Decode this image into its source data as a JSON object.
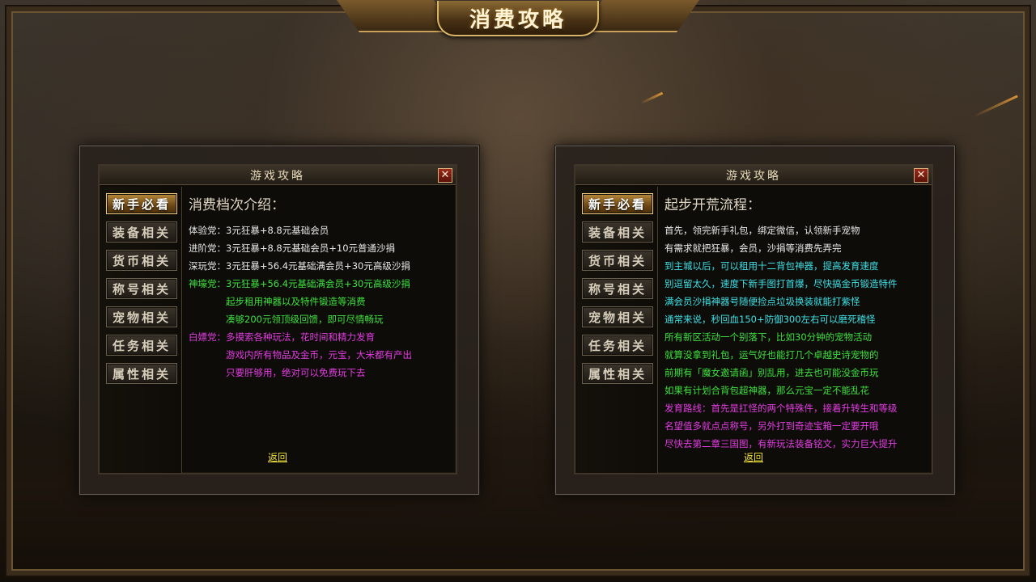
{
  "banner": {
    "title": "消费攻略"
  },
  "left_panel": {
    "window_title": "游戏攻略",
    "close_label": "✕",
    "sidebar": [
      {
        "label": "新手必看",
        "active": true
      },
      {
        "label": "装备相关",
        "active": false
      },
      {
        "label": "货币相关",
        "active": false
      },
      {
        "label": "称号相关",
        "active": false
      },
      {
        "label": "宠物相关",
        "active": false
      },
      {
        "label": "任务相关",
        "active": false
      },
      {
        "label": "属性相关",
        "active": false
      }
    ],
    "heading": "消费档次介绍：",
    "lines": [
      {
        "label": "体验党：",
        "text": "3元狂暴+8.8元基础会员",
        "color": "#e8e8e8"
      },
      {
        "label": "进阶党：",
        "text": "3元狂暴+8.8元基础会员+10元普通沙捐",
        "color": "#e8e8e8"
      },
      {
        "label": "深玩党：",
        "text": "3元狂暴+56.4元基础满会员+30元高级沙捐",
        "color": "#e8e8e8"
      },
      {
        "label": "神壕党：",
        "text": "3元狂暴+56.4元基础满会员+30元高级沙捐",
        "color": "#3ee03e"
      },
      {
        "label": "",
        "text": "起步租用神器以及特件锻造等消费",
        "color": "#3ee03e"
      },
      {
        "label": "",
        "text": "凑够200元领顶级回馈，即可尽情畅玩",
        "color": "#3ee03e"
      },
      {
        "label": "白嫖党：",
        "text": "多摸索各种玩法，花时间和精力发育",
        "color": "#e23ce2"
      },
      {
        "label": "",
        "text": "游戏内所有物品及金币，元宝，大米都有产出",
        "color": "#e23ce2"
      },
      {
        "label": "",
        "text": "只要肝够用，绝对可以免费玩下去",
        "color": "#e23ce2"
      }
    ],
    "back_label": "返回"
  },
  "right_panel": {
    "window_title": "游戏攻略",
    "close_label": "✕",
    "sidebar": [
      {
        "label": "新手必看",
        "active": true
      },
      {
        "label": "装备相关",
        "active": false
      },
      {
        "label": "货币相关",
        "active": false
      },
      {
        "label": "称号相关",
        "active": false
      },
      {
        "label": "宠物相关",
        "active": false
      },
      {
        "label": "任务相关",
        "active": false
      },
      {
        "label": "属性相关",
        "active": false
      }
    ],
    "heading": "起步开荒流程：",
    "lines": [
      {
        "text": "首先，领完新手礼包，绑定微信，认领新手宠物",
        "color": "#e8e8e8"
      },
      {
        "text": "有需求就把狂暴，会员，沙捐等消费先弄完",
        "color": "#e8e8e8"
      },
      {
        "text": "到主城以后，可以租用十二背包神器，提高发育速度",
        "color": "#3ee0e6"
      },
      {
        "text": "别逗留太久，速度下新手图打首爆，尽快搞金币锻造特件",
        "color": "#3ee0e6"
      },
      {
        "text": "满会员沙捐神器号随便捡点垃圾换装就能打紫怪",
        "color": "#3ee0e6"
      },
      {
        "text": "通常来说，秒回血150+防御300左右可以磨死稽怪",
        "color": "#3ee0e6"
      },
      {
        "text": "所有新区活动一个别落下，比如30分钟的宠物活动",
        "color": "#3ee03e"
      },
      {
        "text": "就算没拿到礼包，运气好也能打几个卓越史诗宠物的",
        "color": "#3ee03e"
      },
      {
        "text": "前期有「魔女邀请函」别乱用，进去也可能没金币玩",
        "color": "#3ee03e"
      },
      {
        "text": "如果有计划合背包超神器，那么元宝一定不能乱花",
        "color": "#3ee03e"
      },
      {
        "text": "发育路线：首先是扛怪的两个特殊件，接着升转生和等级",
        "color": "#e23ce2"
      },
      {
        "text": "名望值多就点点称号，另外打到奇迹宝箱一定要开哦",
        "color": "#e23ce2"
      },
      {
        "text": "尽快去第二章三国图，有新玩法装备铭文，实力巨大提升",
        "color": "#e23ce2"
      }
    ],
    "back_label": "返回"
  }
}
